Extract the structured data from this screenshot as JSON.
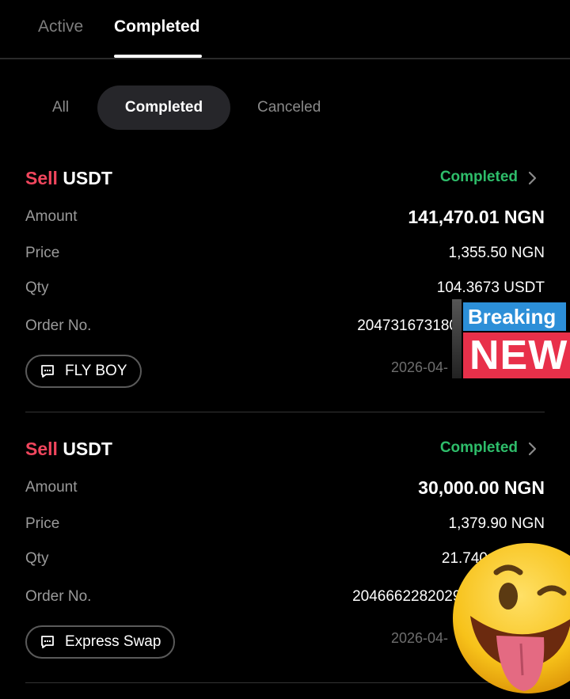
{
  "top_tabs": {
    "active": "Active",
    "completed": "Completed"
  },
  "filters": {
    "all": "All",
    "completed": "Completed",
    "canceled": "Canceled"
  },
  "labels": {
    "amount": "Amount",
    "price": "Price",
    "qty": "Qty",
    "order_no": "Order No."
  },
  "orders": [
    {
      "side": "Sell",
      "asset": "USDT",
      "status": "Completed",
      "amount": "141,470.01 NGN",
      "price": "1,355.50 NGN",
      "qty": "104.3673 USDT",
      "order_no": "204731673180",
      "counterparty": "FLY BOY",
      "date": "2026-04-"
    },
    {
      "side": "Sell",
      "asset": "USDT",
      "status": "Completed",
      "amount": "30,000.00 NGN",
      "price": "1,379.90 NGN",
      "qty": "21.740",
      "order_no": "20466622820299",
      "counterparty": "Express Swap",
      "date": "2026-04-"
    }
  ],
  "sticker": {
    "line1": "Breaking",
    "line2": "NEW"
  },
  "colors": {
    "sell": "#f0465d",
    "completed": "#2ebd6a",
    "background": "#000000"
  },
  "icons": {
    "chevron": "chevron-right-icon",
    "chat": "chat-bubble-icon",
    "emoji": "winking-tongue-emoji"
  }
}
